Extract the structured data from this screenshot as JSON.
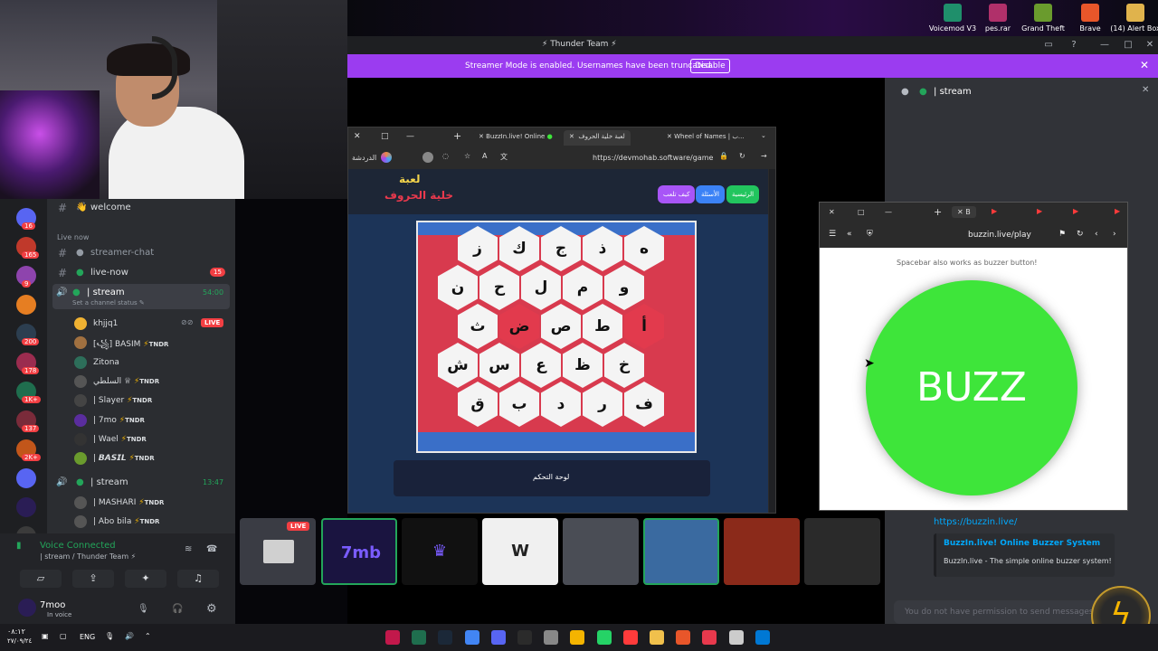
{
  "desktop": {
    "icons": [
      {
        "label": "Voicemod V3",
        "color": "#1f8f6b"
      },
      {
        "label": "pes.rar",
        "color": "#b0306a"
      },
      {
        "label": "Grand Theft",
        "color": "#6a9b2d"
      },
      {
        "label": "Brave",
        "color": "#e8562a"
      },
      {
        "label": "(14) Alert Box",
        "color": "#e0b34c"
      }
    ]
  },
  "titlebar": {
    "title": "Thunder Team"
  },
  "banner": {
    "text": "Streamer Mode is enabled. Usernames have been truncated.",
    "disable": "Disable"
  },
  "servers": [
    {
      "badge": "16"
    },
    {
      "badge": "165"
    },
    {
      "badge": "9"
    },
    {
      "badge": ""
    },
    {
      "badge": "200"
    },
    {
      "badge": "178"
    },
    {
      "badge": "1K+"
    },
    {
      "badge": "137"
    },
    {
      "badge": "2K+"
    },
    {
      "badge": ""
    },
    {
      "badge": ""
    },
    {
      "badge": "NEW"
    }
  ],
  "channels": {
    "welcome": "welcome",
    "category": "Live now",
    "streamer_chat": "streamer-chat",
    "live_now": "live-now",
    "live_now_badge": "15",
    "stream1": "stream",
    "stream1_time": "54:00",
    "stream1_status": "Set a channel status",
    "users1": [
      {
        "name": "khjjq1",
        "tag": "",
        "live": "LIVE",
        "color": "#f0b232"
      },
      {
        "name": "[꧁] BASIM",
        "tag": "TNDR",
        "live": "",
        "color": "#a07040"
      },
      {
        "name": "Zitona",
        "tag": "",
        "live": "",
        "color": "#2d6e5a"
      },
      {
        "name": "السلطي ♕",
        "tag": "TNDR",
        "live": "",
        "color": "#555"
      },
      {
        "name": "| Slayer",
        "tag": "TNDR",
        "live": "",
        "color": "#444"
      },
      {
        "name": "| 7mo",
        "tag": "TNDR",
        "live": "",
        "color": "#5a2d9e"
      },
      {
        "name": "| Wael",
        "tag": "TNDR",
        "live": "",
        "color": "#333"
      },
      {
        "name": "| 𝘽𝘼𝙎𝙄𝙇",
        "tag": "TNDR",
        "live": "",
        "color": "#6a9b2d"
      }
    ],
    "stream2": "stream",
    "stream2_time": "13:47",
    "users2": [
      {
        "name": "| MASHARI",
        "tag": "TNDR",
        "color": "#555"
      },
      {
        "name": "| Abo bila",
        "tag": "TNDR",
        "color": "#555"
      }
    ]
  },
  "voice": {
    "status": "Voice Connected",
    "location": "| stream / Thunder Team",
    "user": "7moo",
    "user_status": "In voice"
  },
  "browser": {
    "tabs": [
      {
        "label": "BuzzIn.live! Online"
      },
      {
        "label": "لعبة خلية الحروف"
      },
      {
        "label": "Wheel of Names | ب..."
      }
    ],
    "profile": "الدردشة",
    "url": "https://devmohab.software/game",
    "game_title_top": "لعبة",
    "game_title_bottom": "خلية الحروف",
    "pills": [
      "الرئيسية",
      "الأسئلة",
      "كيف تلعب"
    ],
    "control_panel": "لوحة التحكم",
    "rows": [
      [
        "ز",
        "ك",
        "ج",
        "ذ",
        "ه"
      ],
      [
        "ن",
        "ح",
        "ل",
        "م",
        "و"
      ],
      [
        "ث",
        "ض",
        "ص",
        "ط",
        "أ"
      ],
      [
        "ش",
        "س",
        "ع",
        "ظ",
        "خ"
      ],
      [
        "ق",
        "ب",
        "د",
        "ر",
        "ف"
      ]
    ]
  },
  "chat": {
    "channel": "stream",
    "link": "https://buzzin.live/",
    "embed_title": "BuzzIn.live! Online Buzzer System",
    "embed_desc": "BuzzIn.live - The simple online buzzer system!",
    "input_placeholder": "You do not have permission to send messages"
  },
  "buzzer": {
    "url": "buzzin.live/play",
    "hint": "Spacebar also works as buzzer button!",
    "button": "BUZZ",
    "tab_active": "B"
  },
  "tiles": [
    {
      "name": "screen-share",
      "live": "LIVE",
      "color": "#3a3c44"
    },
    {
      "name": "7mb",
      "label": "7mb",
      "color": "#1a1440"
    },
    {
      "name": "crown",
      "label": "♛",
      "color": "#111"
    },
    {
      "name": "wael",
      "label": "W",
      "color": "#f0f0f0"
    },
    {
      "name": "car",
      "label": "",
      "color": "#4a4d55"
    },
    {
      "name": "cartoon",
      "label": "",
      "color": "#3a6aa0"
    },
    {
      "name": "luffy",
      "label": "",
      "color": "#8b2a1a"
    },
    {
      "name": "man",
      "label": "",
      "color": "#2a2a2a"
    }
  ],
  "taskbar": {
    "time": "٠٨:١٢",
    "date": "٢٧/٠٩/٢٤",
    "lang": "ENG"
  }
}
